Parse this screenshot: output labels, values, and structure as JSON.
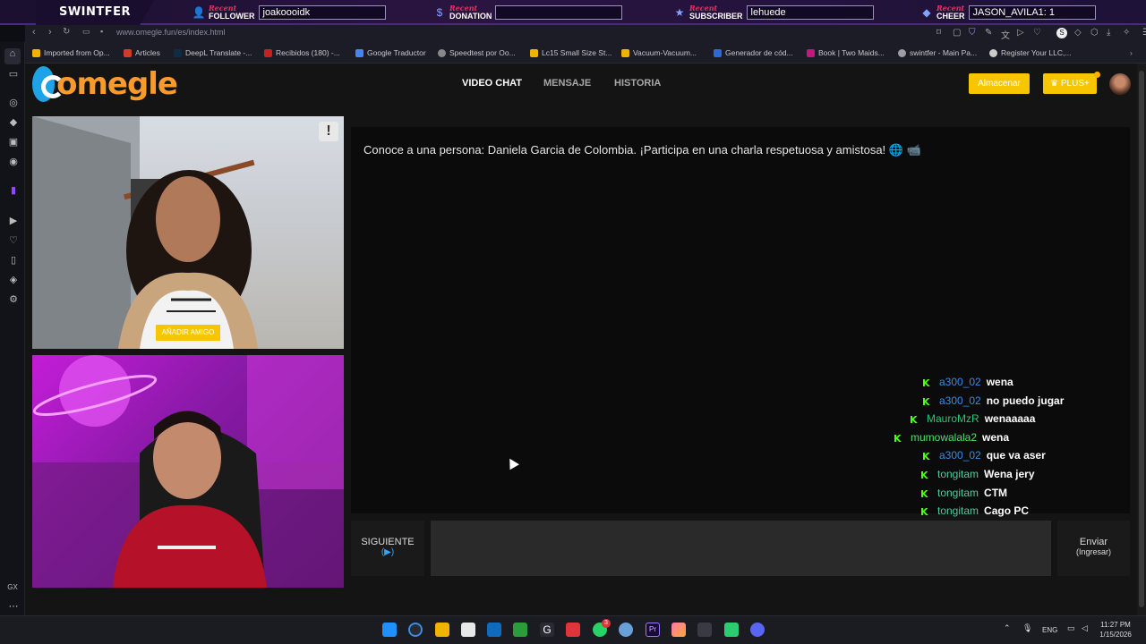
{
  "overlay": {
    "brand": "SWINTFER",
    "recent_label": "Recent",
    "follower": {
      "label": "FOLLOWER",
      "value": "joakoooidk"
    },
    "donation": {
      "label": "DONATION",
      "value": ""
    },
    "subscriber": {
      "label": "SUBSCRIBER",
      "value": "lehuede"
    },
    "cheer": {
      "label": "CHEER",
      "value": "JASON_AVILA1: 1"
    }
  },
  "browser": {
    "url": "www.omegle.fun/es/index.html",
    "bookmarks": [
      {
        "label": "Imported from Op...",
        "color": "#f0b400"
      },
      {
        "label": "Articles",
        "color": "#d23b2b"
      },
      {
        "label": "DeepL Translate -...",
        "color": "#0f2b46"
      },
      {
        "label": "Recibidos (180) -...",
        "color": "#c5221f"
      },
      {
        "label": "Google Traductor",
        "color": "#4285f4"
      },
      {
        "label": "Speedtest por Oo...",
        "color": "#888888"
      },
      {
        "label": "Lc15 Small Size St...",
        "color": "#f0b400"
      },
      {
        "label": "Vacuum-Vacuum...",
        "color": "#f0b400"
      },
      {
        "label": "Generador de cód...",
        "color": "#2a6cd6"
      },
      {
        "label": "Book | Two Maids...",
        "color": "#c2187a"
      },
      {
        "label": "swintfer - Main Pa...",
        "color": "#9aa0a6"
      },
      {
        "label": "Register Your LLC,...",
        "color": "#cccccc"
      }
    ],
    "sidebar_bottom_label": "GX"
  },
  "site": {
    "logo_text": "omegle",
    "tabs": [
      "VIDEO CHAT",
      "MENSAJE",
      "HISTORIA"
    ],
    "store_button": "Almacenar",
    "plus_button": "♛ PLUS+",
    "add_friend": "AÑADIR AMIGO",
    "report": "!"
  },
  "chat": {
    "intro": "Conoce a una persona: Daniela Garcia de Colombia. ¡Participa en una charla respetuosa y amistosa! 🌐 📹",
    "messages": [
      {
        "user": "a300_02",
        "text": "wena",
        "color": "#3b8be0"
      },
      {
        "user": "a300_02",
        "text": "no puedo jugar",
        "color": "#3b8be0"
      },
      {
        "user": "MauroMzR",
        "text": "wenaaaaa",
        "color": "#2fc27a"
      },
      {
        "user": "mumowalala2",
        "text": "wena",
        "color": "#4fe06a"
      },
      {
        "user": "a300_02",
        "text": "que va aser",
        "color": "#3b8be0"
      },
      {
        "user": "tongitam",
        "text": "Wena jery",
        "color": "#53c9a0"
      },
      {
        "user": "tongitam",
        "text": "CTM",
        "color": "#53c9a0"
      },
      {
        "user": "tongitam",
        "text": "Cago PC",
        "color": "#53c9a0"
      }
    ],
    "next_button": "SIGUIENTE",
    "next_sub": "(▶)",
    "send_button": "Enviar",
    "send_sub": "(Ingresar)"
  },
  "taskbar": {
    "lang": "ENG",
    "time": "11:27 PM",
    "date": "1/15/2026",
    "whatsapp_badge": "3"
  }
}
